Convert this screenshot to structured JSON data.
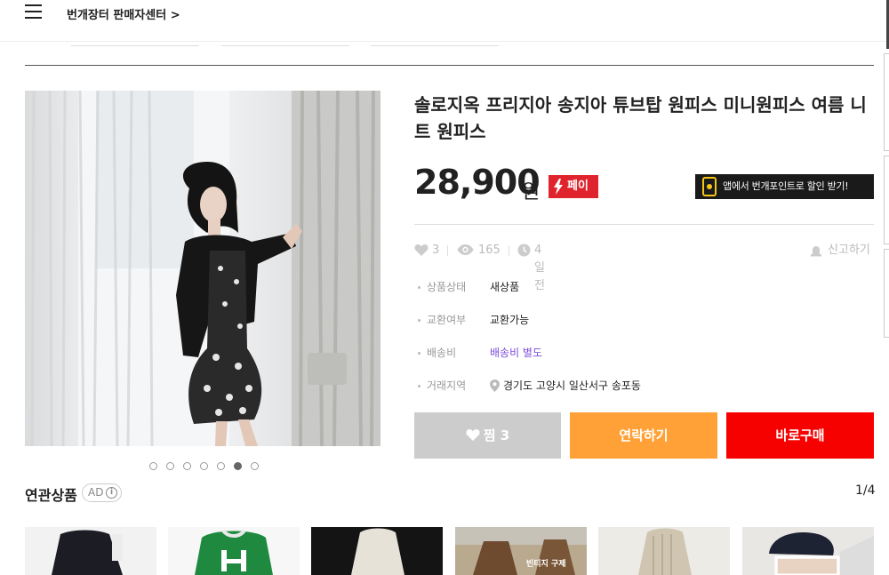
{
  "header": {
    "seller_center_link": "번개장터 판매자센터 >"
  },
  "product": {
    "title": "솔로지옥 프리지아 송지아 튜브탑 원피스 미니원피스 여름 니트 원피스",
    "price": "28,900",
    "currency": "원",
    "pay_badge": "페이",
    "app_banner": "앱에서 번개포인트로 할인 받기!",
    "image_count": 7,
    "active_image_index": 5
  },
  "stats": {
    "likes": "3",
    "views": "165",
    "time_ago": "4일 전",
    "report_label": "신고하기"
  },
  "details": [
    {
      "label": "상품상태",
      "value": "새상품"
    },
    {
      "label": "교환여부",
      "value": "교환가능"
    },
    {
      "label": "배송비",
      "value": "배송비 별도"
    },
    {
      "label": "거래지역",
      "value": "경기도 고양시 일산서구 송포동"
    }
  ],
  "actions": {
    "like_label": "찜 3",
    "contact_label": "연락하기",
    "buy_label": "바로구매"
  },
  "related": {
    "title": "연관상품",
    "ad_label": "AD",
    "page_indicator": "1/4",
    "thumbnails": [
      {
        "icon": "black-dress-thumbnail",
        "caption": ""
      },
      {
        "icon": "green-sweater-thumbnail",
        "caption": ""
      },
      {
        "icon": "white-dress-thumbnail",
        "caption": ""
      },
      {
        "icon": "vintage-coat-thumbnail",
        "caption": "빈티지 구제"
      },
      {
        "icon": "knit-set-thumbnail",
        "caption": ""
      },
      {
        "icon": "cap-model-thumbnail",
        "caption": ""
      }
    ]
  },
  "colors": {
    "pay_red": "#e0242d",
    "contact_orange": "#ffa136",
    "buy_red": "#f70000",
    "like_gray": "#cccccc",
    "shipping_purple": "#7c4ddd"
  }
}
